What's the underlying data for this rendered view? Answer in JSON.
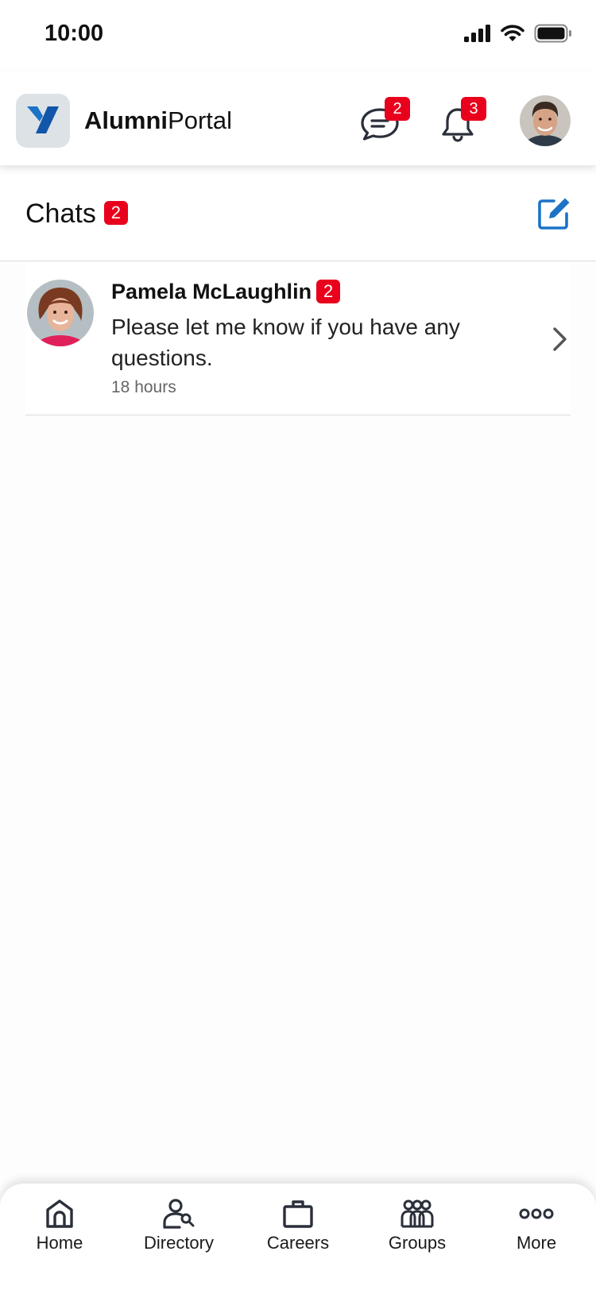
{
  "status_bar": {
    "time": "10:00"
  },
  "header": {
    "brand_bold": "Alumni",
    "brand_regular": "Portal",
    "messages_badge": "2",
    "notifications_badge": "3"
  },
  "chats": {
    "title": "Chats",
    "count": "2"
  },
  "chat_list": [
    {
      "name": "Pamela McLaughlin",
      "unread": "2",
      "message": "Please let me know if you have any questions.",
      "time": "18 hours"
    }
  ],
  "nav": {
    "items": [
      {
        "label": "Home",
        "icon": "home-icon"
      },
      {
        "label": "Directory",
        "icon": "directory-icon"
      },
      {
        "label": "Careers",
        "icon": "briefcase-icon"
      },
      {
        "label": "Groups",
        "icon": "groups-icon"
      },
      {
        "label": "More",
        "icon": "more-icon"
      }
    ]
  },
  "colors": {
    "badge": "#e8001c",
    "accent": "#1a73c7",
    "text": "#1a1a1a"
  }
}
